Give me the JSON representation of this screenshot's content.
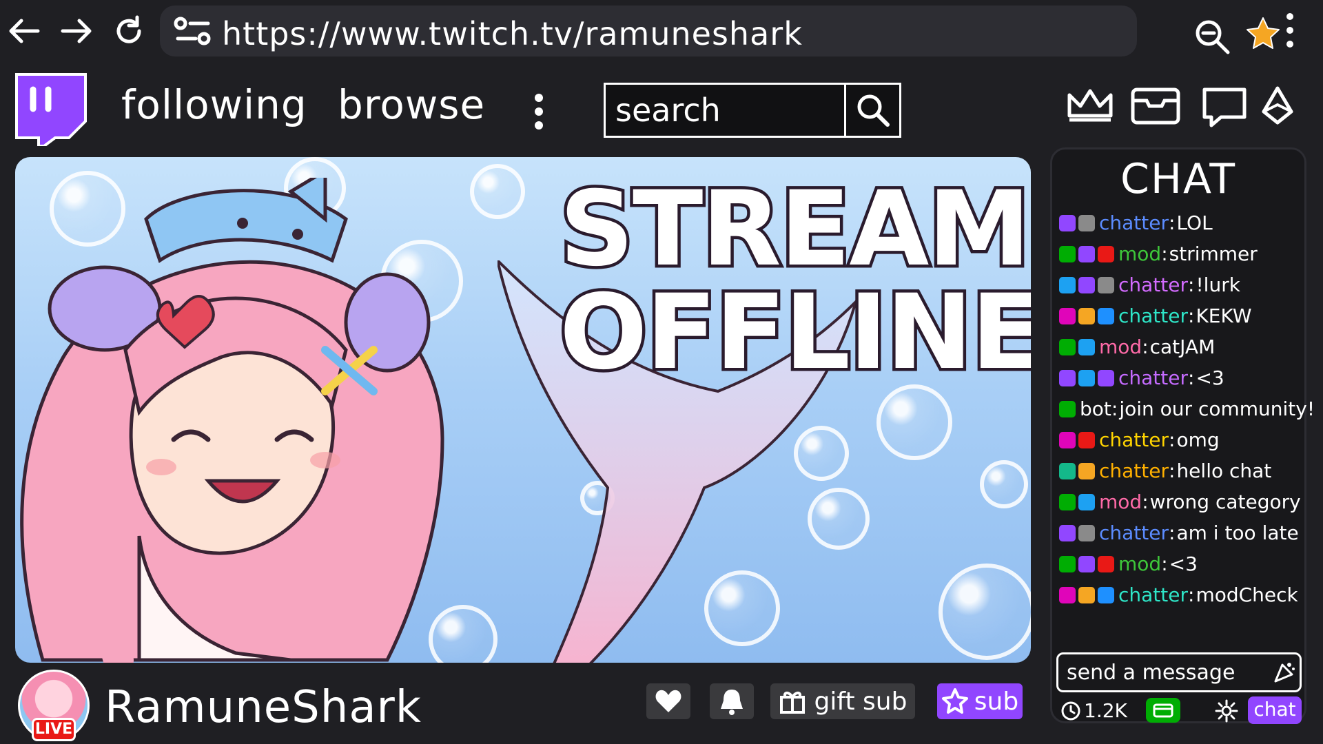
{
  "browser": {
    "url": "https://www.twitch.tv/ramuneshark",
    "icons": [
      "back-arrow-icon",
      "forward-arrow-icon",
      "reload-icon",
      "site-settings-icon",
      "zoom-out-icon",
      "bookmark-star-icon",
      "menu-kebab-icon"
    ]
  },
  "header": {
    "nav": [
      "following",
      "browse"
    ],
    "search_placeholder": "search",
    "icons": [
      "crown-icon",
      "inbox-icon",
      "whispers-icon",
      "bits-icon"
    ]
  },
  "stream": {
    "offline_line1": "STREAM",
    "offline_line2": "OFFLINE"
  },
  "channel": {
    "name": "RamuneShark",
    "live_label": "LIVE",
    "gift_sub_label": "gift sub",
    "sub_label": "sub"
  },
  "chat": {
    "title": "CHAT",
    "messages": [
      {
        "badges": [
          "#9147ff",
          "#8a8a8a"
        ],
        "user": "chatter",
        "user_color": "#5b8cff",
        "text": "LOL"
      },
      {
        "badges": [
          "#00ad03",
          "#9147ff",
          "#e91916"
        ],
        "user": "mod",
        "user_color": "#3ec63a",
        "text": "strimmer"
      },
      {
        "badges": [
          "#1da1f2",
          "#9147ff",
          "#8a8a8a"
        ],
        "user": "chatter",
        "user_color": "#d36bff",
        "text": "!lurk"
      },
      {
        "badges": [
          "#e005b9",
          "#f5a623",
          "#1e90ff"
        ],
        "user": "chatter",
        "user_color": "#2ee6c8",
        "text": "KEKW"
      },
      {
        "badges": [
          "#00ad03",
          "#1da1f2"
        ],
        "user": "mod",
        "user_color": "#ff6aa8",
        "text": "catJAM"
      },
      {
        "badges": [
          "#9147ff",
          "#1da1f2",
          "#9147ff"
        ],
        "user": "chatter",
        "user_color": "#c56bff",
        "text": "<3"
      },
      {
        "badges": [
          "#00ad03"
        ],
        "user": "bot",
        "user_color": "#ffffff",
        "text": "join our community!"
      },
      {
        "badges": [
          "#e005b9",
          "#e91916"
        ],
        "user": "chatter",
        "user_color": "#ffd400",
        "text": "omg"
      },
      {
        "badges": [
          "#14b88a",
          "#f5a623"
        ],
        "user": "chatter",
        "user_color": "#ffb000",
        "text": "hello chat"
      },
      {
        "badges": [
          "#00ad03",
          "#1da1f2"
        ],
        "user": "mod",
        "user_color": "#ff6aa8",
        "text": "wrong category"
      },
      {
        "badges": [
          "#9147ff",
          "#8a8a8a"
        ],
        "user": "chatter",
        "user_color": "#5b8cff",
        "text": "am i too late"
      },
      {
        "badges": [
          "#00ad03",
          "#9147ff",
          "#e91916"
        ],
        "user": "mod",
        "user_color": "#3ec63a",
        "text": "<3"
      },
      {
        "badges": [
          "#e005b9",
          "#f5a623",
          "#1e90ff"
        ],
        "user": "chatter",
        "user_color": "#2ee6c8",
        "text": "modCheck"
      }
    ],
    "input_placeholder": "send a message",
    "viewer_count": "1.2K",
    "chat_button": "chat"
  },
  "colors": {
    "brand_purple": "#9146ff",
    "live_red": "#e91916",
    "background": "#1f1f23"
  }
}
